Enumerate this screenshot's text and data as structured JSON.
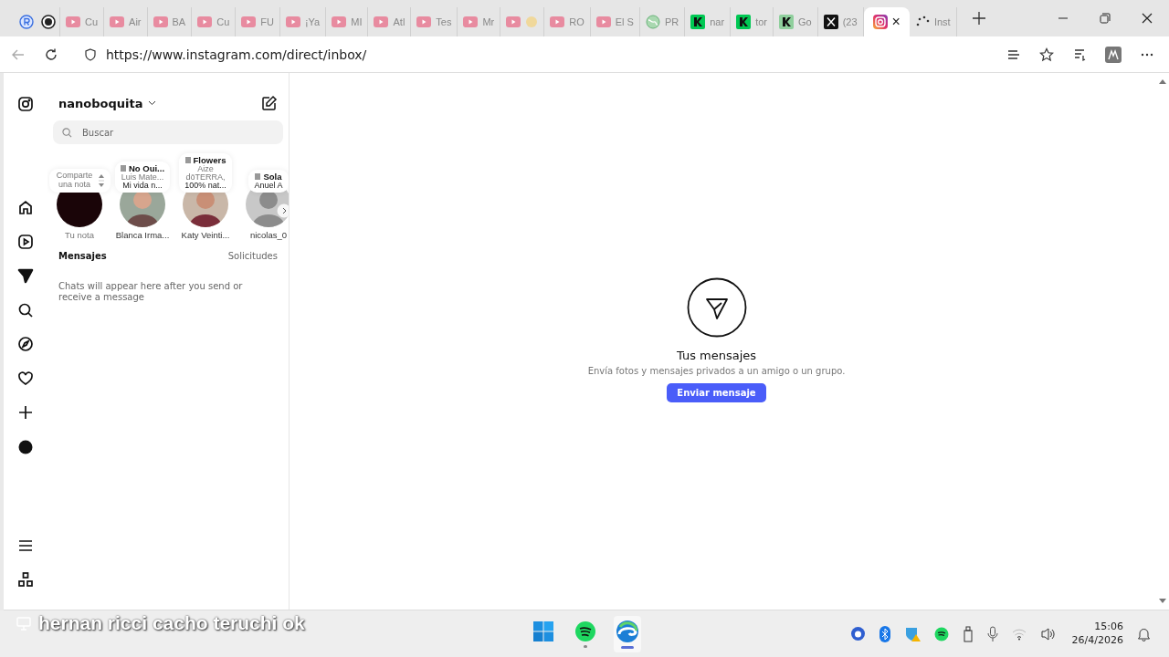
{
  "browser": {
    "tabs": [
      {
        "kind": "pinned",
        "selected": false
      },
      {
        "kind": "record",
        "selected": false
      },
      {
        "kind": "video",
        "label": "Cu",
        "selected": false
      },
      {
        "kind": "video",
        "label": "Air",
        "selected": false
      },
      {
        "kind": "video",
        "label": "BA",
        "selected": false
      },
      {
        "kind": "video",
        "label": "Cu",
        "selected": false
      },
      {
        "kind": "video",
        "label": "FU",
        "selected": false
      },
      {
        "kind": "video",
        "label": "¡Ya",
        "selected": false
      },
      {
        "kind": "video",
        "label": "MI",
        "selected": false
      },
      {
        "kind": "video",
        "label": "Atl",
        "selected": false
      },
      {
        "kind": "video",
        "label": "Tes",
        "selected": false
      },
      {
        "kind": "video",
        "label": "Mr",
        "selected": false
      },
      {
        "kind": "emoji",
        "selected": false
      },
      {
        "kind": "video",
        "label": "RO",
        "selected": false
      },
      {
        "kind": "video",
        "label": "El S",
        "selected": false
      },
      {
        "kind": "globe",
        "label": "PR",
        "selected": false
      },
      {
        "kind": "letter",
        "label": "nar",
        "selected": false
      },
      {
        "kind": "letter",
        "label": "tor",
        "selected": false
      },
      {
        "kind": "faded",
        "label": "Go",
        "selected": false
      },
      {
        "kind": "cross",
        "label": "(23",
        "selected": false
      },
      {
        "kind": "camera",
        "close": "×",
        "selected": true
      },
      {
        "kind": "loading",
        "label": "Inst",
        "selected": false
      }
    ],
    "url": "https://www.instagram.com/direct/inbox/"
  },
  "nav": [
    {
      "selected": false
    },
    {
      "selected": false
    },
    {
      "selected": false
    },
    {
      "selected": true
    },
    {
      "selected": false
    },
    {
      "selected": false
    },
    {
      "selected": false
    },
    {
      "selected": false
    },
    {
      "selected": false
    },
    {
      "selected": false
    },
    {
      "selected": false
    }
  ],
  "inbox": {
    "username": "nanoboquita",
    "search": {
      "placeholder": "Buscar"
    },
    "notes": [
      {
        "kind": "own",
        "lines": [
          "Comparte una nota"
        ],
        "name": "Tu nota"
      },
      {
        "kind": "music",
        "title": "No Oui...",
        "lines": [
          "Luis Mate...",
          "Mi vida n..."
        ],
        "name": "Blanca Irma..."
      },
      {
        "kind": "music",
        "title": "Flowers",
        "lines": [
          "Aize",
          "dōTERRA,",
          "100% nat..."
        ],
        "name": "Katy Veinti..."
      },
      {
        "kind": "music",
        "title": "Sola",
        "lines": [
          "Anuel A"
        ],
        "name": "nicolas_0"
      }
    ],
    "heading": "Mensajes",
    "requests": "Solicitudes",
    "empty": "Chats will appear here after you send or receive a message"
  },
  "main": {
    "title": "Tus mensajes",
    "subtitle": "Envía fotos y mensajes privados a un amigo o un grupo.",
    "button": "Enviar mensaje"
  },
  "caption": "hernan ricci cacho teruchi ok",
  "taskbar": {
    "apps": [
      {
        "selected": false
      },
      {
        "selected": false
      },
      {
        "selected": true
      }
    ],
    "time": "15:06",
    "date": "26/4/2026"
  }
}
